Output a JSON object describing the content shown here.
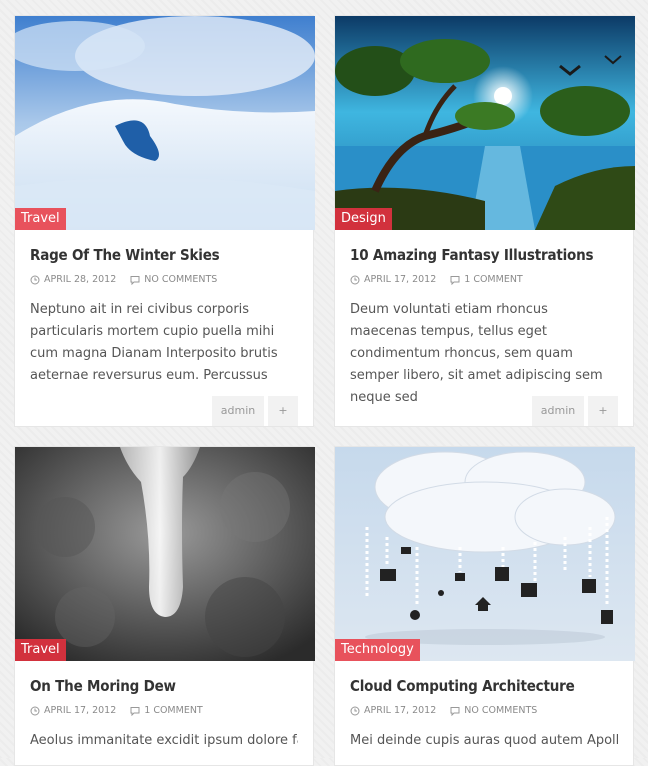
{
  "posts": [
    {
      "category": "Travel",
      "title": "Rage Of The Winter Skies",
      "date": "APRIL 28, 2012",
      "comments": "NO COMMENTS",
      "excerpt": "Neptuno ait in rei civibus corporis particularis mortem cupio puella mihi cum magna Dianam Interposito brutis aeternae reversurus eum. Percussus",
      "author": "admin",
      "plus": "+"
    },
    {
      "category": "Design",
      "title": "10 Amazing Fantasy Illustrations",
      "date": "APRIL 17, 2012",
      "comments": "1 COMMENT",
      "excerpt": "Deum voluntati etiam rhoncus maecenas tempus, tellus eget condimentum rhoncus, sem quam semper libero, sit amet adipiscing sem neque sed",
      "author": "admin",
      "plus": "+"
    },
    {
      "category": "Travel",
      "title": "On The Moring Dew",
      "date": "APRIL 17, 2012",
      "comments": "1 COMMENT",
      "excerpt": "Aeolus immanitate excidit ipsum dolore facto"
    },
    {
      "category": "Technology",
      "title": "Cloud Computing Architecture",
      "date": "APRIL 17, 2012",
      "comments": "NO COMMENTS",
      "excerpt": "Mei deinde cupis auras quod autem Apolloni"
    }
  ],
  "colors": {
    "category_red": "#d2313d",
    "category_pink": "#e8525c"
  }
}
